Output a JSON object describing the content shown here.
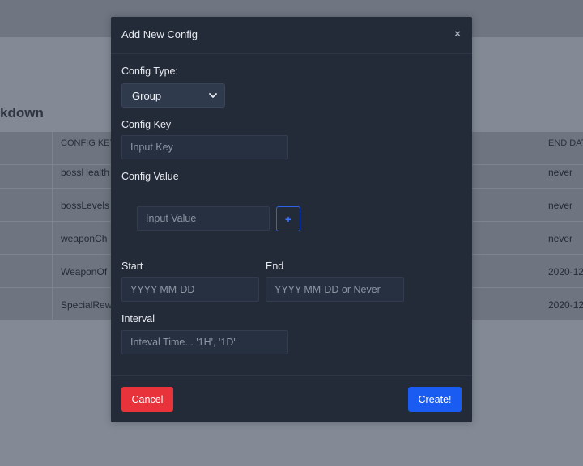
{
  "background": {
    "title": "kdown",
    "table": {
      "headers": {
        "key": "CONFIG KEY",
        "end": "END DAT"
      },
      "rows": [
        {
          "key": "bossHealth",
          "end": "never"
        },
        {
          "key": "bossLevels",
          "end": "never"
        },
        {
          "key": "weaponCh",
          "end": "never"
        },
        {
          "key": "WeaponOf",
          "end": "2020-12"
        },
        {
          "key": "SpecialRew",
          "end": "2020-12"
        }
      ]
    }
  },
  "modal": {
    "title": "Add New Config",
    "close_glyph": "×",
    "config_type": {
      "label": "Config Type:",
      "selected": "Group"
    },
    "config_key": {
      "label": "Config Key",
      "placeholder": "Input Key"
    },
    "config_value": {
      "label": "Config Value",
      "placeholder": "Input Value",
      "add_glyph": "+"
    },
    "start": {
      "label": "Start",
      "placeholder": "YYYY-MM-DD"
    },
    "end": {
      "label": "End",
      "placeholder": "YYYY-MM-DD or Never"
    },
    "interval": {
      "label": "Interval",
      "placeholder": "Inteval Time... '1H', '1D'"
    },
    "cancel_label": "Cancel",
    "create_label": "Create!"
  },
  "colors": {
    "modal_bg": "#232a38",
    "primary": "#1a5cf2",
    "danger": "#e8333b",
    "overlay": "#838a96"
  },
  "icons": {
    "close": "close-icon",
    "select_chevron": "chevron-down-icon",
    "add": "plus-icon"
  }
}
